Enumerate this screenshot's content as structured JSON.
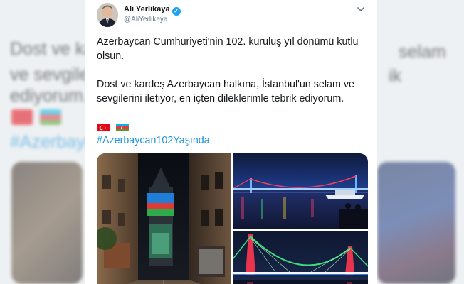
{
  "tweet": {
    "author_name": "Ali Yerlikaya",
    "handle": "@AliYerlikaya",
    "paragraph1": "Azerbaycan Cumhuriyeti'nin 102. kuruluş yıl dönümü kutlu olsun.",
    "paragraph2": "Dost ve kardeş Azerbaycan halkına, İstanbul'un selam ve sevgilerini iletiyor, en içten dileklerimle tebrik ediyorum.",
    "flags": [
      "turkey-flag",
      "azerbaijan-flag"
    ],
    "hashtag": "#Azerbaycan102Yaşında",
    "icons": {
      "verified": "verified-badge-icon",
      "menu": "chevron-down-icon"
    }
  },
  "background": {
    "line1": "Dost ve ka",
    "line2": "ve sevgile",
    "line3": "ediyorum.",
    "line1_right": "selam",
    "line2_right": "ik",
    "hashtag": "#Azerbayc"
  },
  "colors": {
    "link": "#1b95e0",
    "text": "#14171a",
    "secondary": "#657786",
    "verified": "#1da1f2"
  }
}
